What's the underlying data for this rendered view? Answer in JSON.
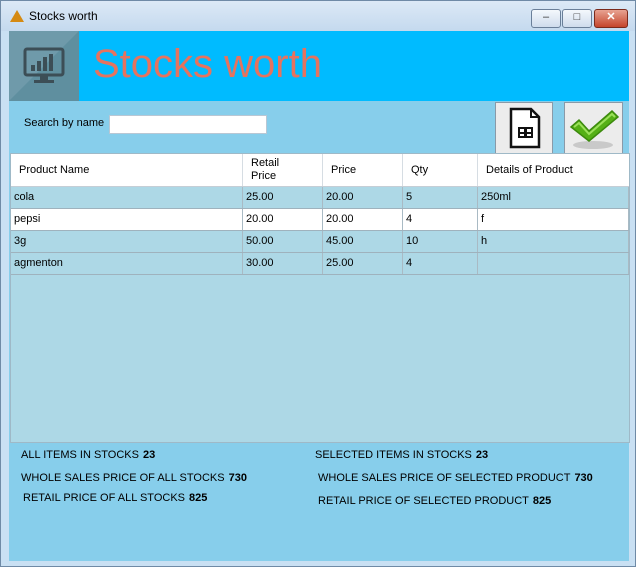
{
  "window": {
    "title": "Stocks worth",
    "minimize": "–",
    "maximize": "□",
    "close": "✕"
  },
  "header": {
    "title": "Stocks worth"
  },
  "search": {
    "label": "Search by name",
    "value": ""
  },
  "icons": {
    "logo": "monitor-chart-icon",
    "report": "document-icon",
    "ok": "checkmark-icon"
  },
  "colors": {
    "header_band": "#00bbff",
    "title_text": "#e5735f",
    "panel": "#87ceeb",
    "grid_bg": "#add8e6",
    "check": "#55b016"
  },
  "table": {
    "columns": [
      "Product Name",
      "Retail\nPrice",
      "Price",
      "Qty",
      "Details of Product"
    ],
    "rows": [
      [
        "cola",
        "25.00",
        "20.00",
        "5",
        "250ml"
      ],
      [
        "pepsi",
        "20.00",
        "20.00",
        "4",
        "f"
      ],
      [
        "3g",
        "50.00",
        "45.00",
        "10",
        "h"
      ],
      [
        "agmenton",
        "30.00",
        "25.00",
        "4",
        ""
      ]
    ]
  },
  "summary": {
    "all_items_label": "ALL ITEMS IN STOCKS",
    "all_items_value": "23",
    "selected_items_label": "SELECTED ITEMS IN STOCKS",
    "selected_items_value": "23",
    "wholesale_all_label": "WHOLE SALES PRICE OF ALL STOCKS",
    "wholesale_all_value": "730",
    "wholesale_selected_label": "WHOLE SALES PRICE OF SELECTED PRODUCT",
    "wholesale_selected_value": "730",
    "retail_all_label": "RETAIL PRICE OF ALL STOCKS",
    "retail_all_value": "825",
    "retail_selected_label": "RETAIL PRICE OF SELECTED PRODUCT",
    "retail_selected_value": "825"
  }
}
